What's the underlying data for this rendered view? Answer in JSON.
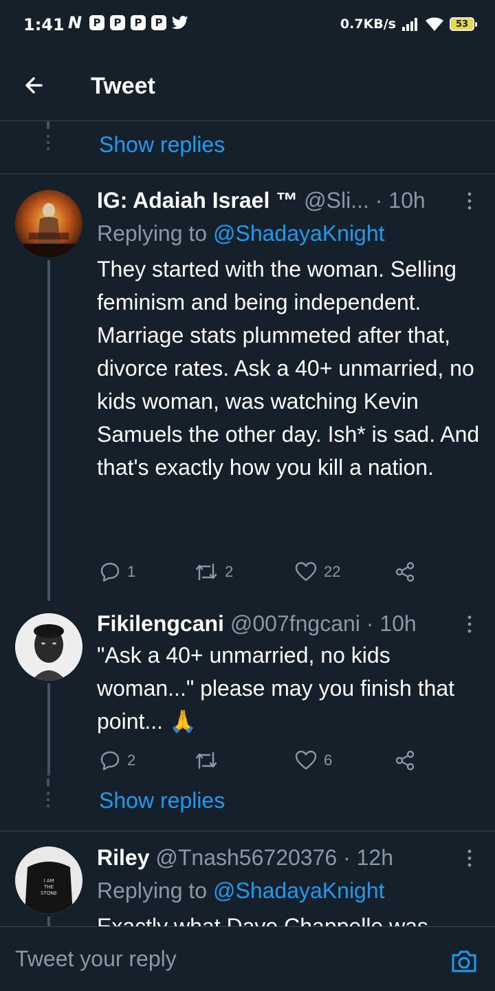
{
  "status_bar": {
    "time": "1:41",
    "app_icons": [
      "N",
      "P",
      "P",
      "P",
      "P"
    ],
    "network_speed": "0.7KB/s",
    "battery": "53"
  },
  "header": {
    "title": "Tweet"
  },
  "show_replies_label": "Show replies",
  "tweets": [
    {
      "name": "IG: Adaiah Israel ™",
      "handle": "@Sli...",
      "time": "· 10h",
      "replying_prefix": "Replying to ",
      "replying_to": "@ShadayaKnight",
      "text": "They started with the woman. Selling feminism and being independent. Marriage stats plummeted after that, divorce rates. Ask a 40+ unmarried, no kids woman, was watching Kevin Samuels the other day. Ish* is sad. And that's exactly how you kill a nation.",
      "replies": "1",
      "retweets": "2",
      "likes": "22"
    },
    {
      "name": "Fikilengcani",
      "handle": "@007fngcani",
      "time": "· 10h",
      "text": "\"Ask a 40+ unmarried, no kids woman...\" please may you finish that point...  🙏",
      "replies": "2",
      "retweets": "",
      "likes": "6"
    },
    {
      "name": "Riley",
      "handle": "@Tnash56720376",
      "time": "· 12h",
      "replying_prefix": "Replying to ",
      "replying_to": "@ShadayaKnight",
      "text": "Exactly what Dave Chappelle was"
    }
  ],
  "composer": {
    "placeholder": "Tweet your reply"
  },
  "colors": {
    "background": "#15202b",
    "accent": "#1d9bf0",
    "muted": "#8899a6",
    "divider": "#38444d"
  }
}
